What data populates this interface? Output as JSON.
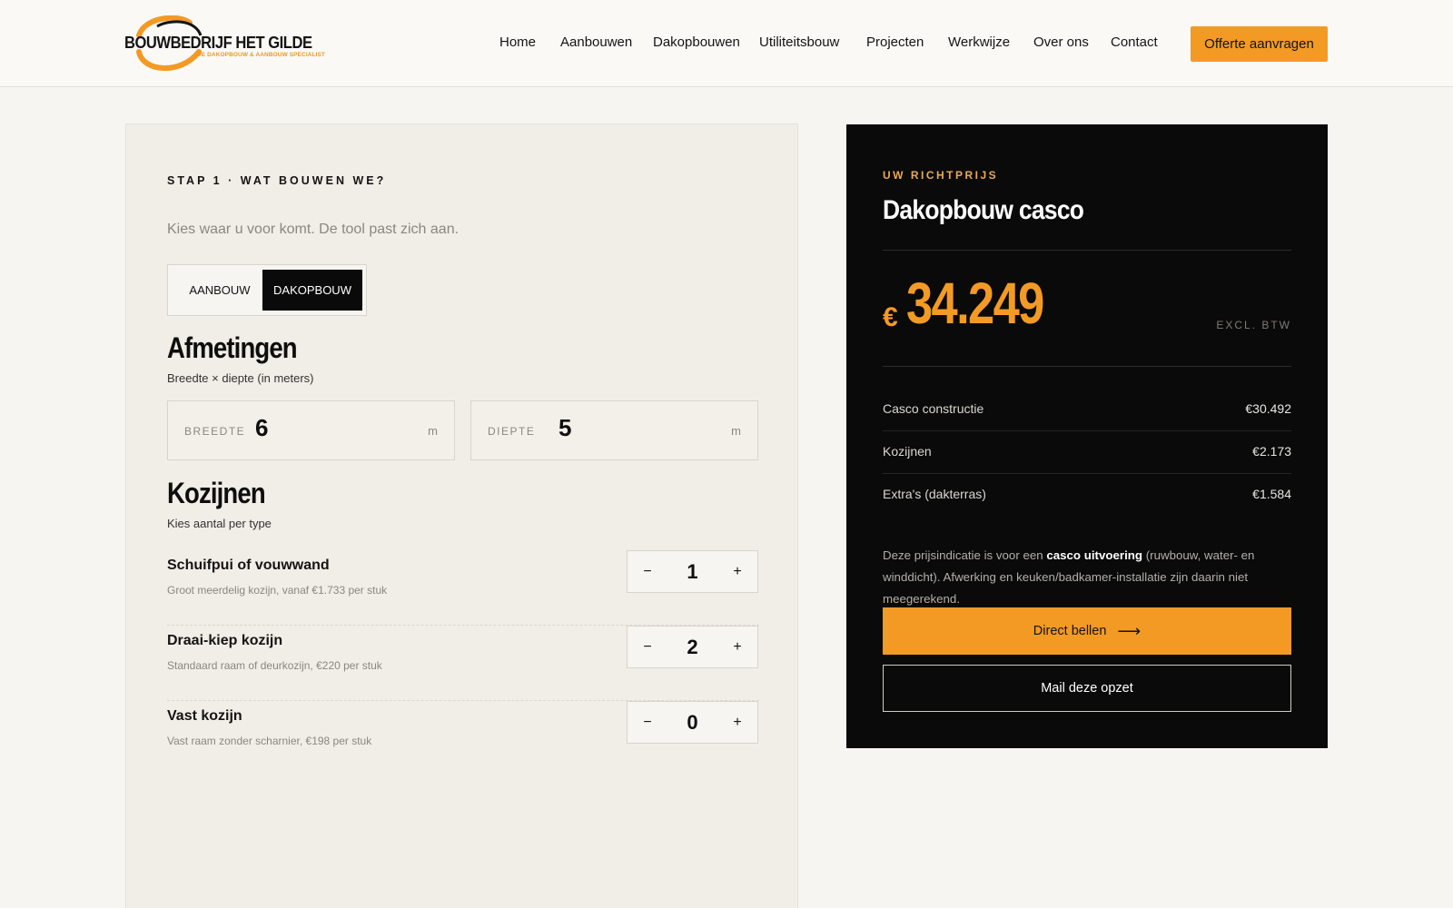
{
  "brand": {
    "name": "BOUWBEDRIJF HET GILDE",
    "tagline": "DE DAKOPBOUW & AANBOUW SPECIALIST"
  },
  "nav": {
    "items": [
      "Home",
      "Aanbouwen",
      "Dakopbouwen",
      "Utiliteitsbouw",
      "Projecten",
      "Werkwijze",
      "Over ons",
      "Contact"
    ],
    "cta": "Offerte aanvragen"
  },
  "configurator": {
    "step": "STAP 1 · WAT BOUWEN WE?",
    "intro": "Kies waar u voor komt. De tool past zich aan.",
    "types": [
      "AANBOUW",
      "DAKOPBOUW"
    ],
    "selected_type": "DAKOPBOUW",
    "dimensions": {
      "title": "Afmetingen",
      "subtitle": "Breedte × diepte (in meters)",
      "width_label": "BREEDTE",
      "width_value": "6",
      "depth_label": "DIEPTE",
      "depth_value": "5",
      "unit": "m"
    },
    "frames": {
      "title": "Kozijnen",
      "subtitle": "Kies aantal per type",
      "items": [
        {
          "name": "Schuifpui of vouwwand",
          "desc": "Groot meerdelig kozijn, vanaf €1.733 per stuk",
          "qty": "1"
        },
        {
          "name": "Draai-kiep kozijn",
          "desc": "Standaard raam of deurkozijn, €220 per stuk",
          "qty": "2"
        },
        {
          "name": "Vast kozijn",
          "desc": "Vast raam zonder scharnier, €198 per stuk",
          "qty": "0"
        }
      ],
      "minus": "−",
      "plus": "+"
    }
  },
  "quote": {
    "eyebrow": "UW RICHTPRIJS",
    "title": "Dakopbouw casco",
    "currency": "€",
    "amount": "34.249",
    "vat_note": "EXCL. BTW",
    "lines": [
      {
        "label": "Casco constructie",
        "value": "€30.492"
      },
      {
        "label": "Kozijnen",
        "value": "€2.173"
      },
      {
        "label": "Extra's (dakterras)",
        "value": "€1.584"
      }
    ],
    "note_pre": "Deze prijsindicatie is voor een ",
    "note_bold": "casco uitvoering",
    "note_post": " (ruwbouw, water- en winddicht). Afwerking en keuken/badkamer-installatie zijn daarin niet meegerekend.",
    "call_label": "Direct bellen",
    "call_arrow": "⟶",
    "mail_label": "Mail deze opzet"
  }
}
